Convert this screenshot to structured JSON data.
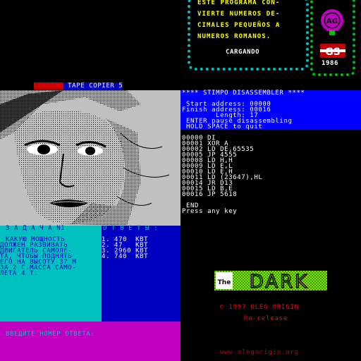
{
  "spanish_panel": {
    "lines": [
      "ESTE PROGRAMA CON-",
      "VIERTE NUMEROS DE-",
      "CIMALES PEQUEÑOS A",
      "NUMEROS ROMANOS."
    ],
    "status": "CARGANDO",
    "badge_text": "AG",
    "logo_text": "GS",
    "year": "1986"
  },
  "loading_bar": {
    "word": "LOADING",
    "rest": " TAPE COPIER 5"
  },
  "quiz": {
    "title": "З А Д А Ч А N1",
    "lines": [
      "КАКУЮ МОЩНОСТЬ",
      "ДОЛЖЕН РАЗВИВАТЬ",
      "ДВИГАТЕЛЬ САМОЛЕ-",
      "ТА, ЧТОБЫ ПОДНЯТЬ",
      "ЕГО НА ВЫСОТУ 37 М",
      "ЗА 2 С.МАССА САМО-",
      "ЛЕТА 4 Т."
    ],
    "answers_title": "О Т В Е Т Ы :",
    "answers": [
      "1. 470  КВТ",
      "2. 47   КВТ",
      "3. 2960 КВТ",
      "4. 740  КВТ"
    ],
    "prompt": "ВВЕДИТЕ НОМЕР ОТВЕТА:"
  },
  "disassembler": {
    "header": "**** STIMPO DISASSEMBLER ****",
    "start_line": " Start address: 00000",
    "finish_line": "Finish address: 00016",
    "length_line": "        Length: 17",
    "enter_line": " ENTER pause disassembling",
    "hold_line": " HOLD SPACE to quit",
    "listing": [
      "00000 DI",
      "00001 XOR A",
      "00002 LD DE,65535",
      "00005 JP 4555",
      "00008 LD H,H",
      "00009 LD E,L",
      "00010 LD E,H",
      "00011 LD (23647),HL",
      "00014 JR D13",
      "00015 LD B,E",
      "00016 JP 5618"
    ],
    "end": " END",
    "press": "Press any key"
  },
  "the_dark": {
    "logo_small": "The",
    "logo_big": "DARK",
    "copyright": "© 1997 OLEG ORIGIN",
    "rerelease": "Re-release",
    "url": "www.olegorigin.org"
  },
  "colors": {
    "zx_blue": "#0000c0",
    "zx_bright_blue": "#0000ff",
    "zx_cyan": "#00c0c0",
    "zx_magenta": "#c000c0",
    "zx_gray": "#c0c0c0",
    "zx_red": "#ff0000",
    "zx_yellow": "#ffff00"
  }
}
